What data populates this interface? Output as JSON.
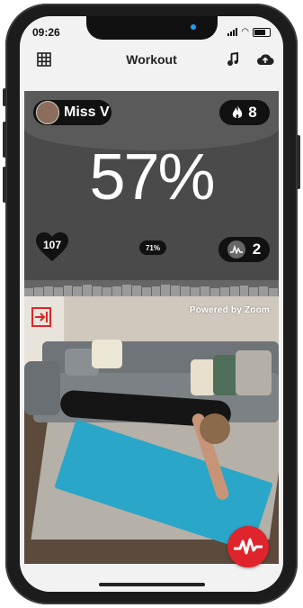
{
  "status_bar": {
    "time": "09:26"
  },
  "nav": {
    "title": "Workout",
    "left_icon": "grid-icon",
    "music_icon": "music-note-icon",
    "upload_icon": "cloud-upload-icon"
  },
  "workout": {
    "user_name": "Miss V",
    "flame_count": "8",
    "percent": "57%",
    "heart_rate": "107",
    "small_percent": "71%",
    "zone_count": "2",
    "zone_levels": [
      0.5,
      0.55,
      0.6,
      0.55,
      0.65,
      0.6,
      0.7,
      0.6,
      0.55,
      0.6,
      0.7,
      0.65,
      0.55,
      0.6,
      0.7,
      0.65,
      0.6,
      0.55,
      0.6,
      0.5,
      0.55,
      0.6,
      0.65,
      0.55,
      0.6,
      0.5
    ]
  },
  "video": {
    "powered_by": "Powered by Zoom",
    "exit_icon": "exit-icon"
  },
  "colors": {
    "accent_red": "#e0242b",
    "panel_dark": "#4a4a4a",
    "mat_blue": "#2aa6c8"
  }
}
